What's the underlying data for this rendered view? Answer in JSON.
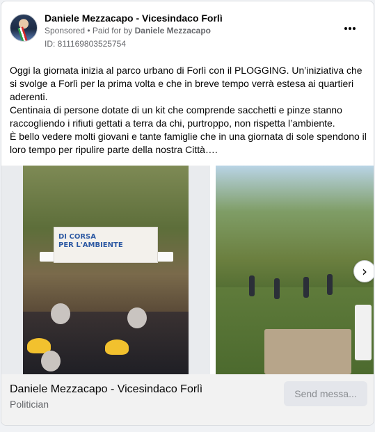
{
  "post": {
    "page_name": "Daniele Mezzacapo - Vicesindaco Forlì",
    "sponsored_label": "Sponsored",
    "separator": " • ",
    "paid_for_prefix": "Paid for by ",
    "paid_for_name": "Daniele Mezzacapo",
    "ad_id": "ID: 811169803525754",
    "more_icon": "ellipsis-icon",
    "paragraphs": [
      "Oggi la giornata inizia al parco urbano di Forlì con il PLOGGING. Un’iniziativa che si svolge a Forlì per la prima volta e che in breve tempo verrà estesa ai quartieri aderenti.",
      "Centinaia di persone dotate di un kit che comprende sacchetti e pinze stanno raccogliendo i rifiuti gettati a terra da chi, purtroppo, non rispetta l’ambiente.",
      "È bello vedere molti giovani e tante famiglie che in una giornata di sole spendono il loro tempo per ripulire parte della nostra Città…."
    ]
  },
  "carousel": {
    "banner_line1": "DI CORSA",
    "banner_line2": "PER L'AMBIENTE",
    "next_icon": "chevron-right-icon",
    "next_glyph": "›"
  },
  "footer": {
    "title": "Daniele Mezzacapo - Vicesindaco Forlì",
    "subtitle": "Politician",
    "cta_label": "Send messa..."
  },
  "colors": {
    "text_primary": "#050505",
    "text_secondary": "#65676b",
    "footer_bg": "#f2f2f2",
    "button_bg": "#e4e6eb"
  }
}
